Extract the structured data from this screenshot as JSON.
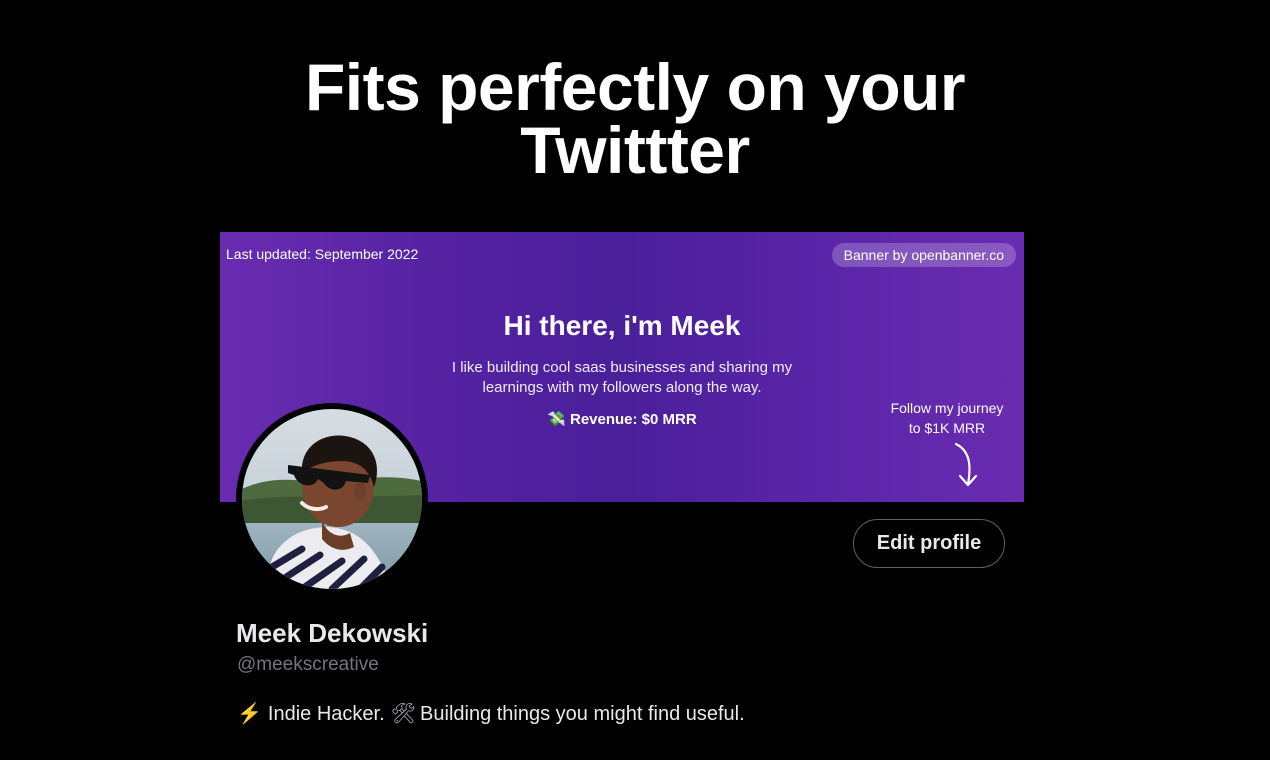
{
  "headline": {
    "line1": "Fits perfectly on your",
    "line2": "Twittter"
  },
  "banner": {
    "updated": "Last updated: September 2022",
    "credit": "Banner by openbanner.co",
    "greeting": "Hi there, i'm Meek",
    "intro": "I like building cool saas businesses and sharing my learnings with my followers along the way.",
    "revenue_icon": "💸",
    "revenue": "Revenue: $0 MRR",
    "journey_line1": "Follow my journey",
    "journey_line2": "to $1K MRR",
    "colors": {
      "start": "#6a2cb1",
      "middle": "#4a1f9a"
    }
  },
  "profile": {
    "edit_button": "Edit profile",
    "name": "Meek Dekowski",
    "handle": "@meekscreative",
    "bio": {
      "icon1": "⚡",
      "part1": "Indie Hacker.",
      "icon2": "🛠",
      "part2": "Building things you might find useful."
    }
  }
}
